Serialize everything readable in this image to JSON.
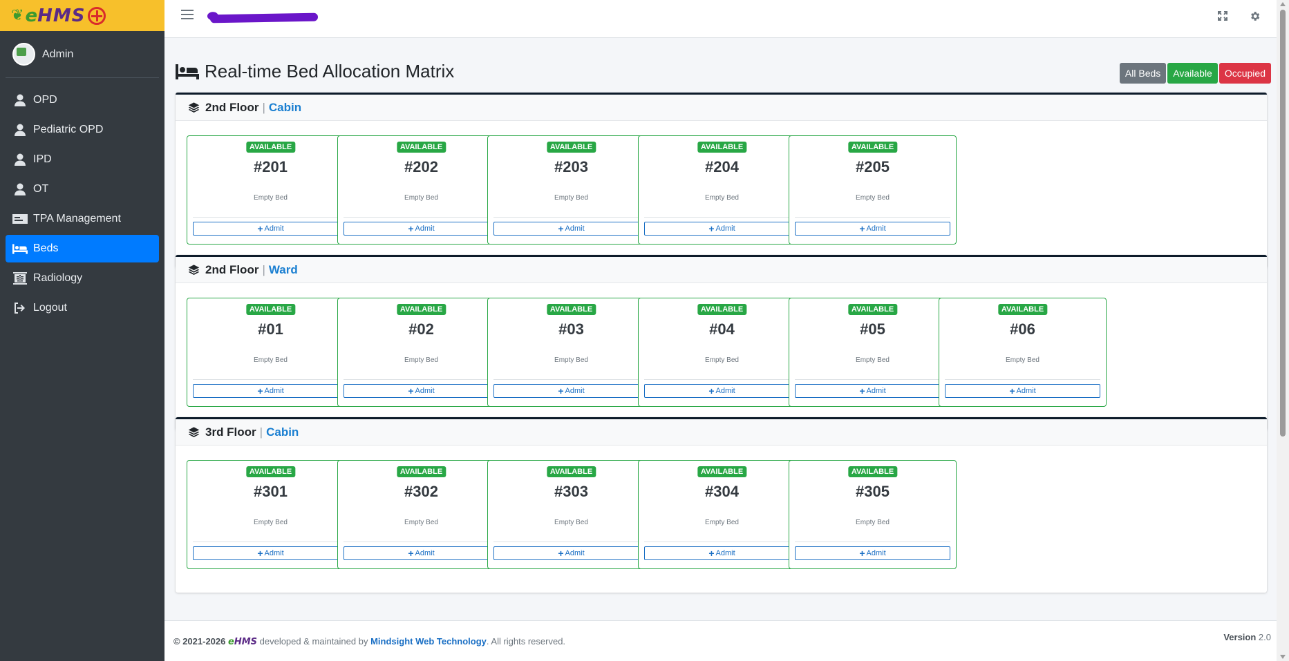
{
  "brand": {
    "logo_text": "eHMS"
  },
  "user": {
    "name": "Admin"
  },
  "nav": [
    {
      "label": "OPD",
      "icon": "user-icon"
    },
    {
      "label": "Pediatric OPD",
      "icon": "user-icon"
    },
    {
      "label": "IPD",
      "icon": "user-icon"
    },
    {
      "label": "OT",
      "icon": "user-icon"
    },
    {
      "label": "TPA Management",
      "icon": "id-card-icon"
    },
    {
      "label": "Beds",
      "icon": "bed-icon",
      "active": true
    },
    {
      "label": "Radiology",
      "icon": "xray-icon"
    },
    {
      "label": "Logout",
      "icon": "logout-icon"
    }
  ],
  "header": {
    "icons": [
      "expand-icon",
      "gear-icon"
    ]
  },
  "page": {
    "title": "Real-time Bed Allocation Matrix"
  },
  "filters": {
    "all": "All Beds",
    "available": "Available",
    "occupied": "Occupied"
  },
  "colors": {
    "accent": "#007bff",
    "available": "#28a745",
    "occupied": "#dc3545",
    "brand_bar": "#f7c02b"
  },
  "sections": [
    {
      "floor": "2nd Floor",
      "type": "Cabin",
      "beds": [
        {
          "badge": "AVAILABLE",
          "number": "#201",
          "status": "Empty Bed",
          "action": "Admit"
        },
        {
          "badge": "AVAILABLE",
          "number": "#202",
          "status": "Empty Bed",
          "action": "Admit"
        },
        {
          "badge": "AVAILABLE",
          "number": "#203",
          "status": "Empty Bed",
          "action": "Admit"
        },
        {
          "badge": "AVAILABLE",
          "number": "#204",
          "status": "Empty Bed",
          "action": "Admit"
        },
        {
          "badge": "AVAILABLE",
          "number": "#205",
          "status": "Empty Bed",
          "action": "Admit"
        }
      ]
    },
    {
      "floor": "2nd Floor",
      "type": "Ward",
      "beds": [
        {
          "badge": "AVAILABLE",
          "number": "#01",
          "status": "Empty Bed",
          "action": "Admit"
        },
        {
          "badge": "AVAILABLE",
          "number": "#02",
          "status": "Empty Bed",
          "action": "Admit"
        },
        {
          "badge": "AVAILABLE",
          "number": "#03",
          "status": "Empty Bed",
          "action": "Admit"
        },
        {
          "badge": "AVAILABLE",
          "number": "#04",
          "status": "Empty Bed",
          "action": "Admit"
        },
        {
          "badge": "AVAILABLE",
          "number": "#05",
          "status": "Empty Bed",
          "action": "Admit"
        },
        {
          "badge": "AVAILABLE",
          "number": "#06",
          "status": "Empty Bed",
          "action": "Admit"
        }
      ]
    },
    {
      "floor": "3rd Floor",
      "type": "Cabin",
      "beds": [
        {
          "badge": "AVAILABLE",
          "number": "#301",
          "status": "Empty Bed",
          "action": "Admit"
        },
        {
          "badge": "AVAILABLE",
          "number": "#302",
          "status": "Empty Bed",
          "action": "Admit"
        },
        {
          "badge": "AVAILABLE",
          "number": "#303",
          "status": "Empty Bed",
          "action": "Admit"
        },
        {
          "badge": "AVAILABLE",
          "number": "#304",
          "status": "Empty Bed",
          "action": "Admit"
        },
        {
          "badge": "AVAILABLE",
          "number": "#305",
          "status": "Empty Bed",
          "action": "Admit"
        }
      ]
    }
  ],
  "footer": {
    "copyright": "© 2021-2026",
    "brand_e": "e",
    "brand_hms": "HMS",
    "developed_text": "developed & maintained by",
    "company": "Mindsight Web Technology",
    "rights": ". All rights reserved.",
    "version_label": "Version",
    "version": "2.0"
  }
}
